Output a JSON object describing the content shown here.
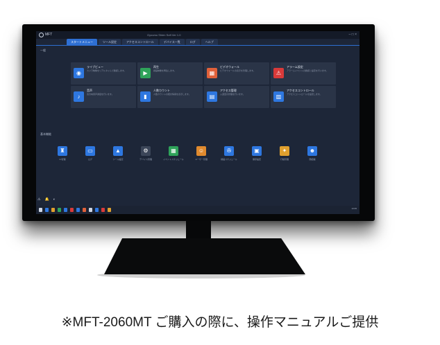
{
  "app": {
    "name": "MFT",
    "window_title": "Gyoumu Shien Soft Ver 1.0",
    "win_controls": "– □ ×"
  },
  "tabs": [
    {
      "label": "スタートメニュー",
      "active": true
    },
    {
      "label": "ツール設定"
    },
    {
      "label": "アクセスコントロール"
    },
    {
      "label": "デバイス一覧"
    },
    {
      "label": "ログ"
    },
    {
      "label": "ヘルプ"
    }
  ],
  "sections": {
    "top": "一般",
    "tools": "基本機能"
  },
  "cards": [
    {
      "title": "ライブビュー",
      "desc": "カメラ映像をリアルタイムで確認します。",
      "icon": "shield-icon",
      "glyph": "◉",
      "color": "#2e77e0"
    },
    {
      "title": "再生",
      "desc": "録画映像を再生します。",
      "icon": "play-icon",
      "glyph": "▶",
      "color": "#2fa35a"
    },
    {
      "title": "ビデオウォール",
      "desc": "ビデオウォールの表示を管理します。",
      "icon": "video-wall-icon",
      "glyph": "▦",
      "color": "#e0613a"
    },
    {
      "title": "アラーム設定",
      "desc": "アラームイベントの確認と設定を行います。",
      "icon": "alarm-icon",
      "glyph": "⚠",
      "color": "#d93a3a"
    },
    {
      "title": "音声",
      "desc": "双方向音声通話を行います。",
      "icon": "microphone-icon",
      "glyph": "♪",
      "color": "#2e77e0"
    },
    {
      "title": "人数カウント",
      "desc": "人数カウントの統計情報を表示します。",
      "icon": "bar-chart-icon",
      "glyph": "▮",
      "color": "#2e77e0"
    },
    {
      "title": "アクセス管理",
      "desc": "入退室の管理を行います。",
      "icon": "access-icon",
      "glyph": "▤",
      "color": "#2e77e0"
    },
    {
      "title": "アクセスコントロール",
      "desc": "アクセスコントロールを設定します。",
      "icon": "access-control-icon",
      "glyph": "▥",
      "color": "#2e77e0"
    }
  ],
  "tools": [
    {
      "label": "IC管理",
      "icon": "person-icon",
      "glyph": "♜",
      "color": "#2e77e0"
    },
    {
      "label": "ログ",
      "icon": "monitor-icon",
      "glyph": "▭",
      "color": "#2e77e0"
    },
    {
      "label": "ツール設定",
      "icon": "chart-icon",
      "glyph": "▲",
      "color": "#2e77e0"
    },
    {
      "label": "デバイス管理",
      "icon": "gear-icon",
      "glyph": "⚙",
      "color": "#3b4558"
    },
    {
      "label": "イベントスケジュール",
      "icon": "schedule-icon",
      "glyph": "▦",
      "color": "#2fa35a"
    },
    {
      "label": "ユーザー管理",
      "icon": "user-icon",
      "glyph": "☺",
      "color": "#e08a2e"
    },
    {
      "label": "録画スケジュール",
      "icon": "film-icon",
      "glyph": "✇",
      "color": "#2e77e0"
    },
    {
      "label": "保存設定",
      "icon": "storage-icon",
      "glyph": "▣",
      "color": "#2e77e0"
    },
    {
      "label": "行動管理",
      "icon": "walk-icon",
      "glyph": "✦",
      "color": "#e0a02e"
    },
    {
      "label": "顔認識",
      "icon": "face-icon",
      "glyph": "☻",
      "color": "#2e77e0"
    }
  ],
  "bottom_icons": [
    "⚠",
    "🔔",
    "◐"
  ],
  "taskbar": {
    "clock": "13:05"
  },
  "caption": "※MFT-2060MT ご購入の際に、操作マニュアルご提供"
}
